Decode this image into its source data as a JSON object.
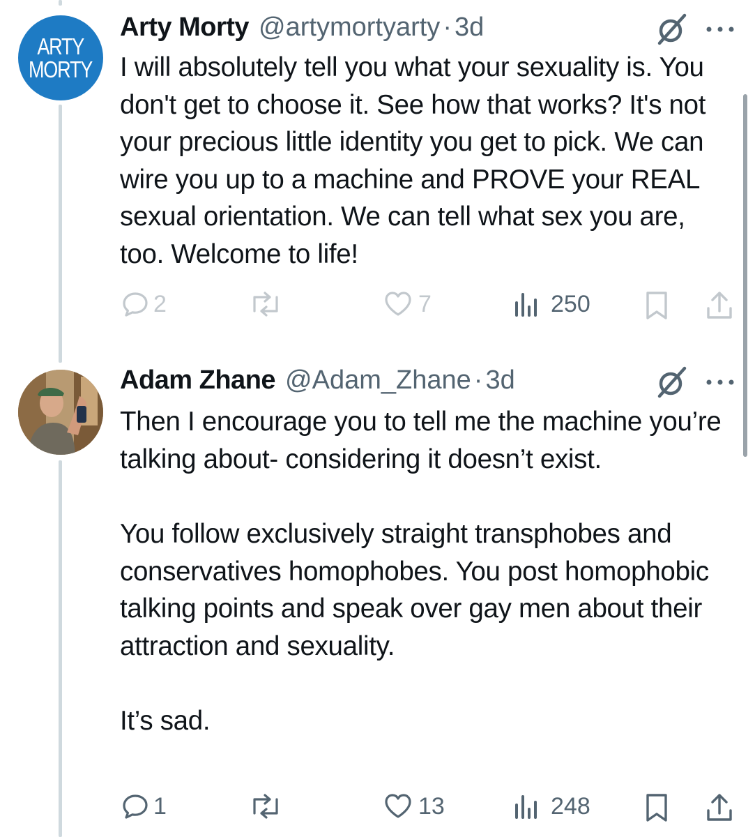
{
  "tweets": [
    {
      "avatar_text": [
        "ARTY",
        "MORTY"
      ],
      "name": "Arty Morty",
      "handle": "@artymortyarty",
      "separator": "·",
      "time": "3d",
      "paragraphs": [
        "I will absolutely tell you what your sexuality is. You don't get to choose it. See how that works? It's not your precious little identity you get to pick. We can wire you up to a machine and PROVE your REAL sexual orientation. We can tell what sex you are, too. Welcome to life!"
      ],
      "replies": "2",
      "reposts": "",
      "likes": "7",
      "views": "250"
    },
    {
      "name": "Adam Zhane",
      "handle": "@Adam_Zhane",
      "separator": "·",
      "time": "3d",
      "paragraphs": [
        "Then I encourage you to tell me the machine you’re talking about- considering it doesn’t exist.",
        "You follow exclusively straight transphobes and conservatives homophobes. You post homophobic talking points and speak over gay men about their attraction and sexuality.",
        "It’s sad."
      ],
      "replies": "1",
      "reposts": "",
      "likes": "13",
      "views": "248"
    }
  ],
  "icons": {
    "reply": "reply-bubble-icon",
    "repost": "repost-arrows-icon",
    "like": "heart-icon",
    "views": "views-bar-chart-icon",
    "bookmark": "bookmark-icon",
    "share": "share-upload-icon",
    "grok": "grok-icon",
    "more": "more-dots-icon"
  },
  "colors": {
    "text": "#0f1419",
    "secondary": "#536471",
    "thread_line": "#cfd9de",
    "avatar_blue": "#1e7bc4"
  }
}
